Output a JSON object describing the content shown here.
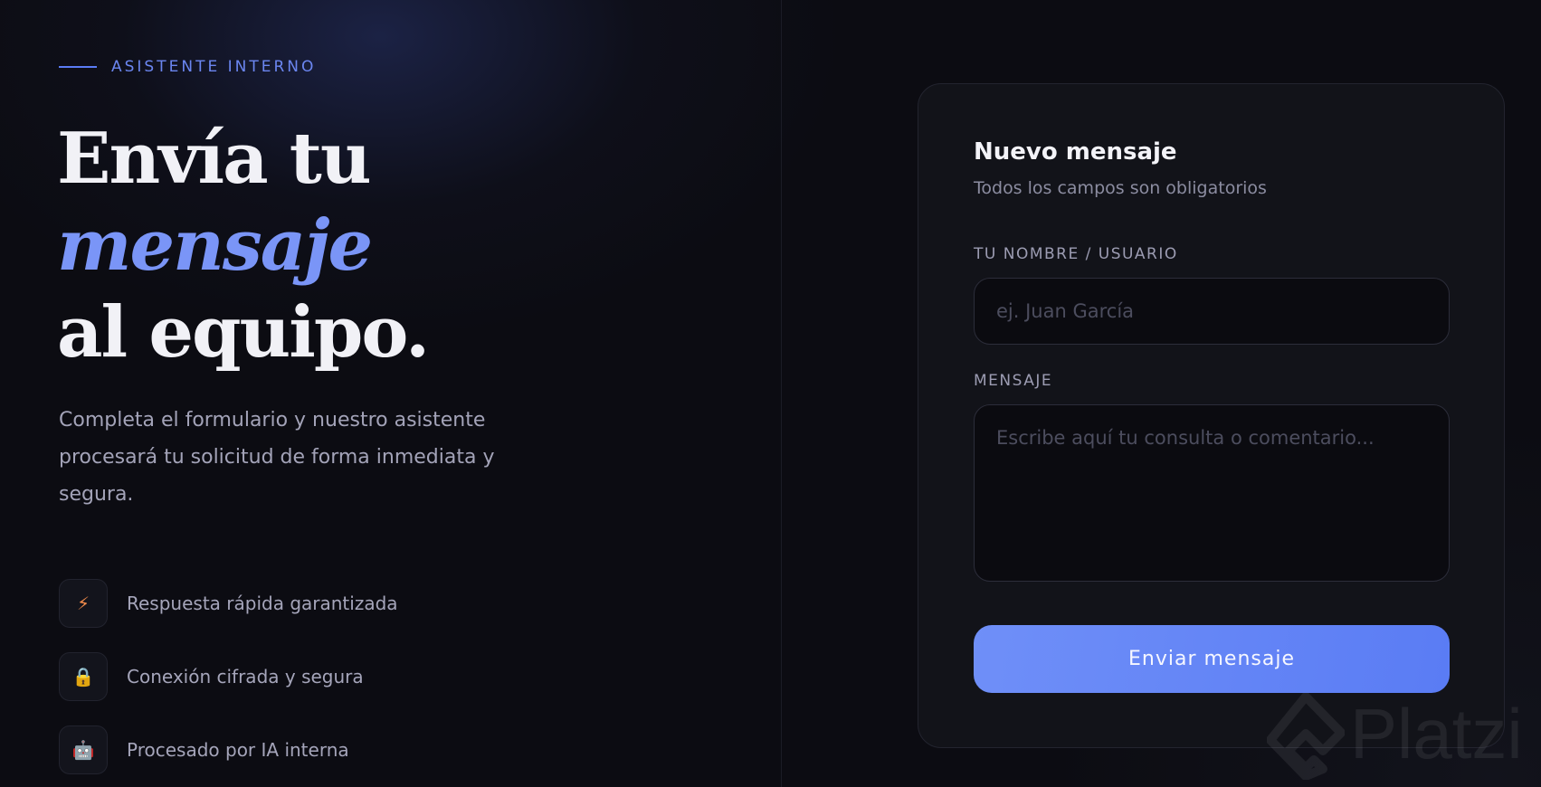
{
  "hero": {
    "eyebrow": "ASISTENTE INTERNO",
    "headline_line1": "Envía tu",
    "headline_line2": "mensaje",
    "headline_line3": "al equipo.",
    "lead": "Completa el formulario y nuestro asistente procesará tu solicitud de forma inmediata y segura."
  },
  "features": [
    {
      "icon": "lightning-icon",
      "glyph": "⚡",
      "label": "Respuesta rápida garantizada"
    },
    {
      "icon": "lock-icon",
      "glyph": "🔒",
      "label": "Conexión cifrada y segura"
    },
    {
      "icon": "robot-icon",
      "glyph": "🤖",
      "label": "Procesado por IA interna"
    }
  ],
  "form": {
    "title": "Nuevo mensaje",
    "subtitle": "Todos los campos son obligatorios",
    "name_label": "TU NOMBRE / USUARIO",
    "name_placeholder": "ej. Juan García",
    "name_value": "",
    "message_label": "MENSAJE",
    "message_placeholder": "Escribe aquí tu consulta o comentario...",
    "message_value": "",
    "submit_label": "Enviar mensaje"
  },
  "watermark": {
    "text": "Platzi",
    "icon": "platzi-logo-icon"
  },
  "colors": {
    "accent": "#5b7cf5",
    "background": "#0c0c12",
    "card": "#121319",
    "button_start": "#6f8ff8",
    "button_end": "#5a7cf4"
  }
}
